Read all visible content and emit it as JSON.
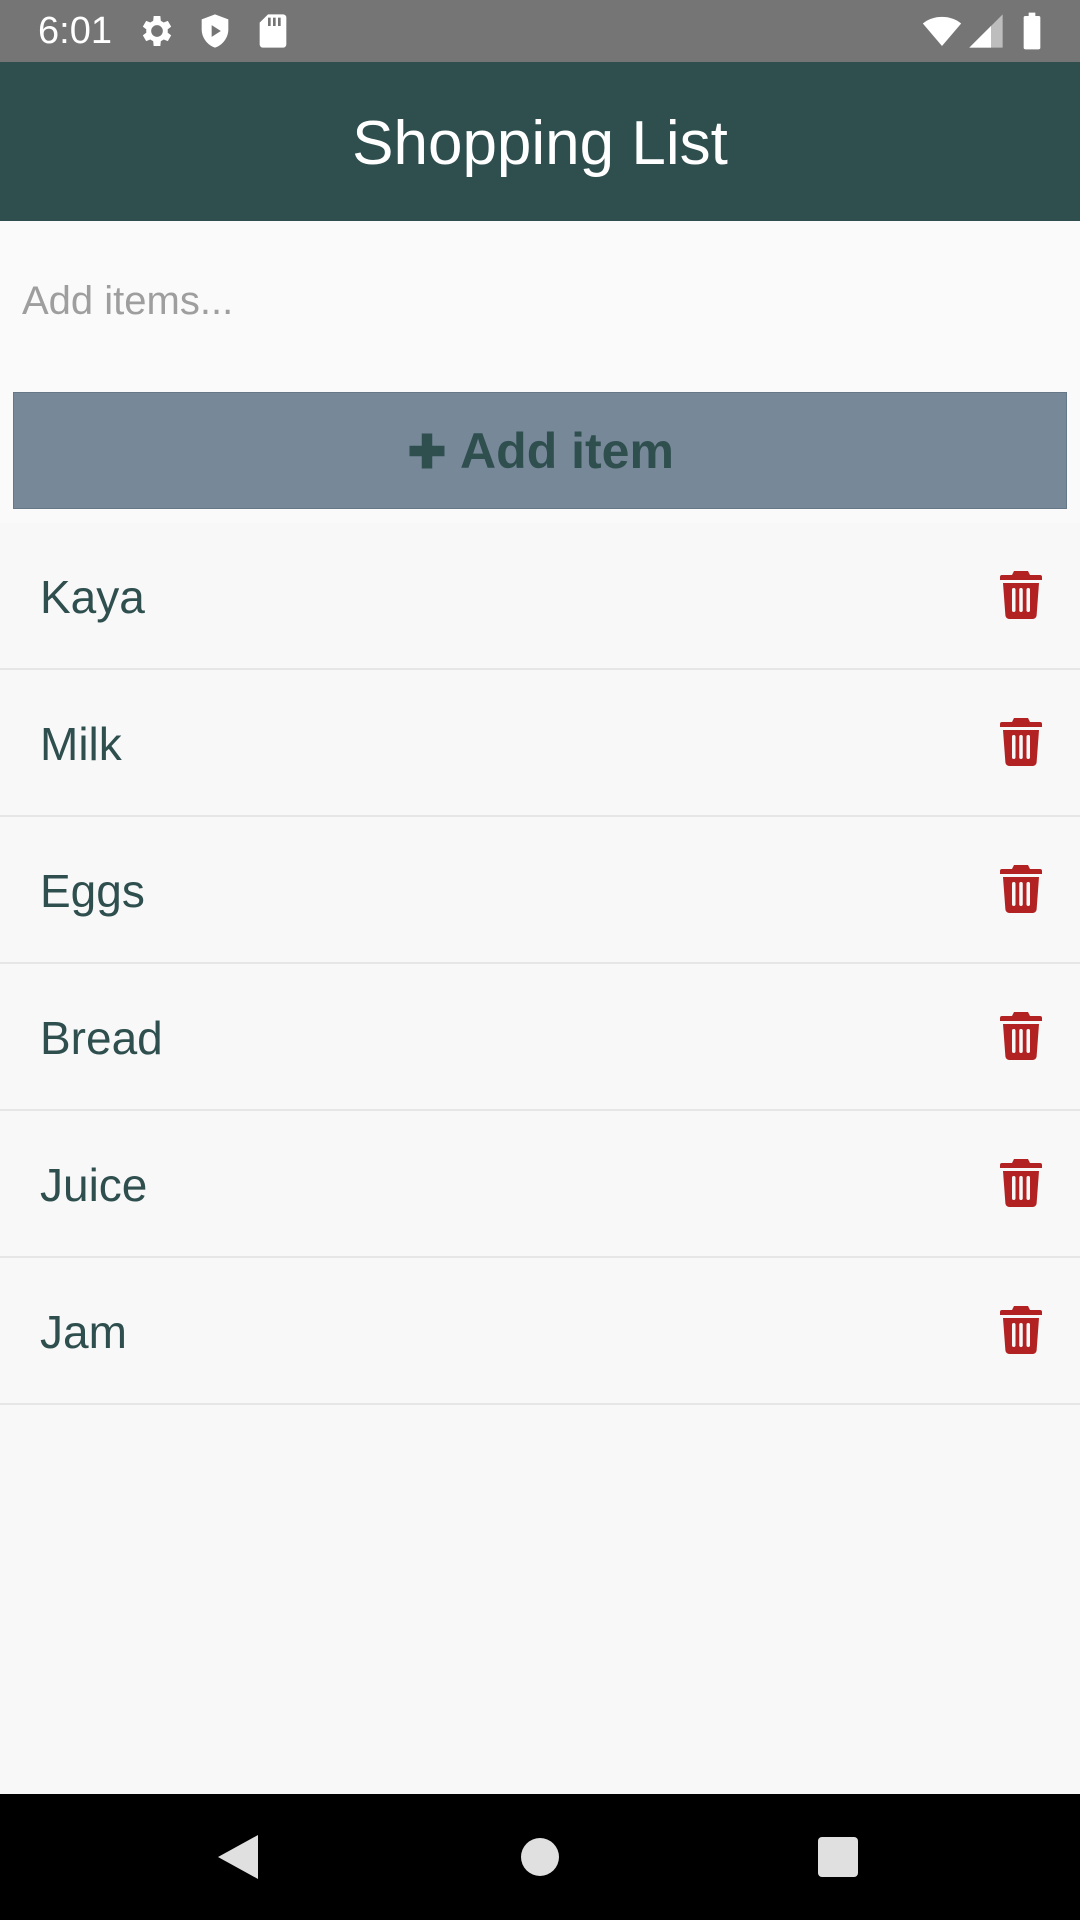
{
  "status_bar": {
    "time": "6:01",
    "left_icons": [
      "gear-icon",
      "shield-play-icon",
      "sd-card-icon"
    ],
    "right_icons": [
      "wifi-icon",
      "cellular-signal-icon",
      "battery-icon"
    ]
  },
  "app_bar": {
    "title": "Shopping List",
    "background": "#2f4f4f"
  },
  "add_form": {
    "input_value": "",
    "input_placeholder": "Add items...",
    "button_label": "Add item",
    "button_icon": "plus-icon",
    "button_background": "#778899"
  },
  "items": [
    {
      "label": "Kaya"
    },
    {
      "label": "Milk"
    },
    {
      "label": "Eggs"
    },
    {
      "label": "Bread"
    },
    {
      "label": "Juice"
    },
    {
      "label": "Jam"
    }
  ],
  "item_action_icon": "trash-icon",
  "colors": {
    "accent": "#2f4f4f",
    "delete": "#b22222",
    "button": "#778899"
  },
  "nav_bar": {
    "buttons": [
      "back-icon",
      "home-icon",
      "recents-icon"
    ]
  }
}
